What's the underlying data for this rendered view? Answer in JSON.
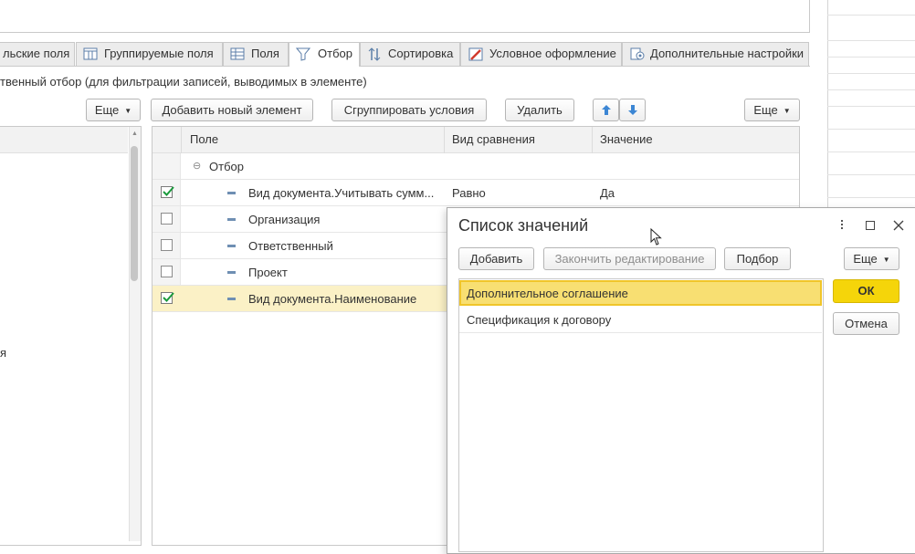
{
  "tabs": [
    {
      "label": "льские поля"
    },
    {
      "label": "Группируемые поля"
    },
    {
      "label": "Поля"
    },
    {
      "label": "Отбор"
    },
    {
      "label": "Сортировка"
    },
    {
      "label": "Условное оформление"
    },
    {
      "label": "Дополнительные настройки"
    }
  ],
  "filter_description": "твенный отбор (для фильтрации записей, выводимых в элементе)",
  "left_pane": {
    "more_button": "Еще",
    "partial_text": "я"
  },
  "toolbar": {
    "add_new_element": "Добавить новый элемент",
    "group_conditions": "Сгруппировать условия",
    "delete": "Удалить",
    "more": "Еще"
  },
  "table": {
    "columns": [
      "Поле",
      "Вид сравнения",
      "Значение"
    ],
    "group_row": "Отбор",
    "rows": [
      {
        "field": "Вид документа.Учитывать сумм...",
        "comparison": "Равно",
        "value": "Да",
        "checked": true
      },
      {
        "field": "Организация",
        "comparison": "",
        "value": "",
        "checked": false
      },
      {
        "field": "Ответственный",
        "comparison": "",
        "value": "",
        "checked": false
      },
      {
        "field": "Проект",
        "comparison": "",
        "value": "",
        "checked": false
      },
      {
        "field": "Вид документа.Наименование",
        "comparison": "",
        "value": "",
        "checked": true
      }
    ]
  },
  "dialog": {
    "title": "Список значений",
    "add": "Добавить",
    "finish_editing": "Закончить редактирование",
    "selection": "Подбор",
    "more": "Еще",
    "ok": "ОК",
    "cancel": "Отмена",
    "items": [
      "Дополнительное соглашение",
      "Спецификация к договору"
    ]
  },
  "colors": {
    "ok_button": "#f5d50a",
    "selected_row": "#fbf1c6",
    "check_green": "#1a9a3c",
    "arrow_blue": "#3c86d4"
  }
}
